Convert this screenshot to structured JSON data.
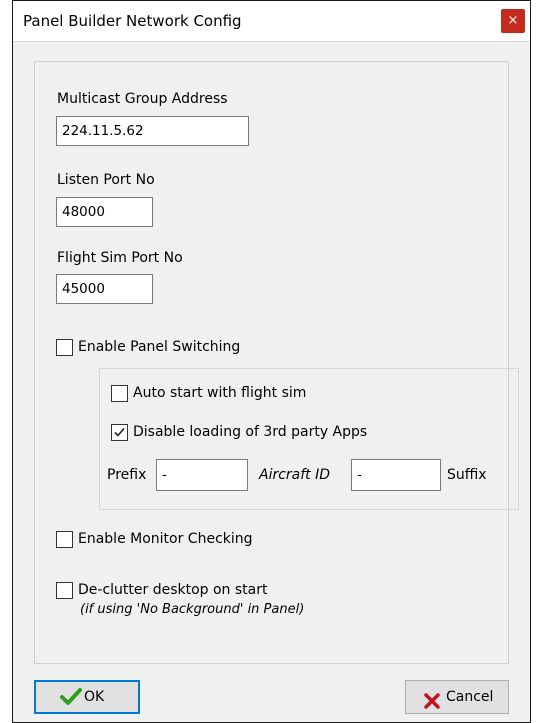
{
  "window": {
    "title": "Panel Builder Network Config",
    "close_glyph": "×"
  },
  "multicast": {
    "label": "Multicast Group Address",
    "value": "224.11.5.62"
  },
  "listen_port": {
    "label": "Listen Port No",
    "value": "48000"
  },
  "flight_sim_port": {
    "label": "Flight Sim Port No",
    "value": "45000"
  },
  "panel_switching": {
    "label": "Enable Panel Switching",
    "checked": false,
    "auto_start": {
      "label": "Auto start with flight sim",
      "checked": false
    },
    "disable_third_party": {
      "label": "Disable loading of 3rd party Apps",
      "checked": true
    },
    "prefix_label": "Prefix",
    "prefix_value": "-",
    "aircraft_id_label": "Aircraft ID",
    "aircraft_id_value": "-",
    "suffix_label": "Suffix"
  },
  "monitor_checking": {
    "label": "Enable Monitor Checking",
    "checked": false
  },
  "declutter": {
    "label": "De-clutter desktop on start",
    "note": "(if using 'No Background' in Panel)",
    "checked": false
  },
  "buttons": {
    "ok_label": "OK",
    "cancel_label": "Cancel"
  },
  "colors": {
    "ok_check": "#2e9e1f",
    "cancel_x": "#c1121f",
    "close_bg": "#c42b1c",
    "default_button_border": "#0078d7"
  },
  "icons": {
    "ok": "checkmark-icon",
    "cancel": "x-mark-icon",
    "close": "close-icon"
  }
}
